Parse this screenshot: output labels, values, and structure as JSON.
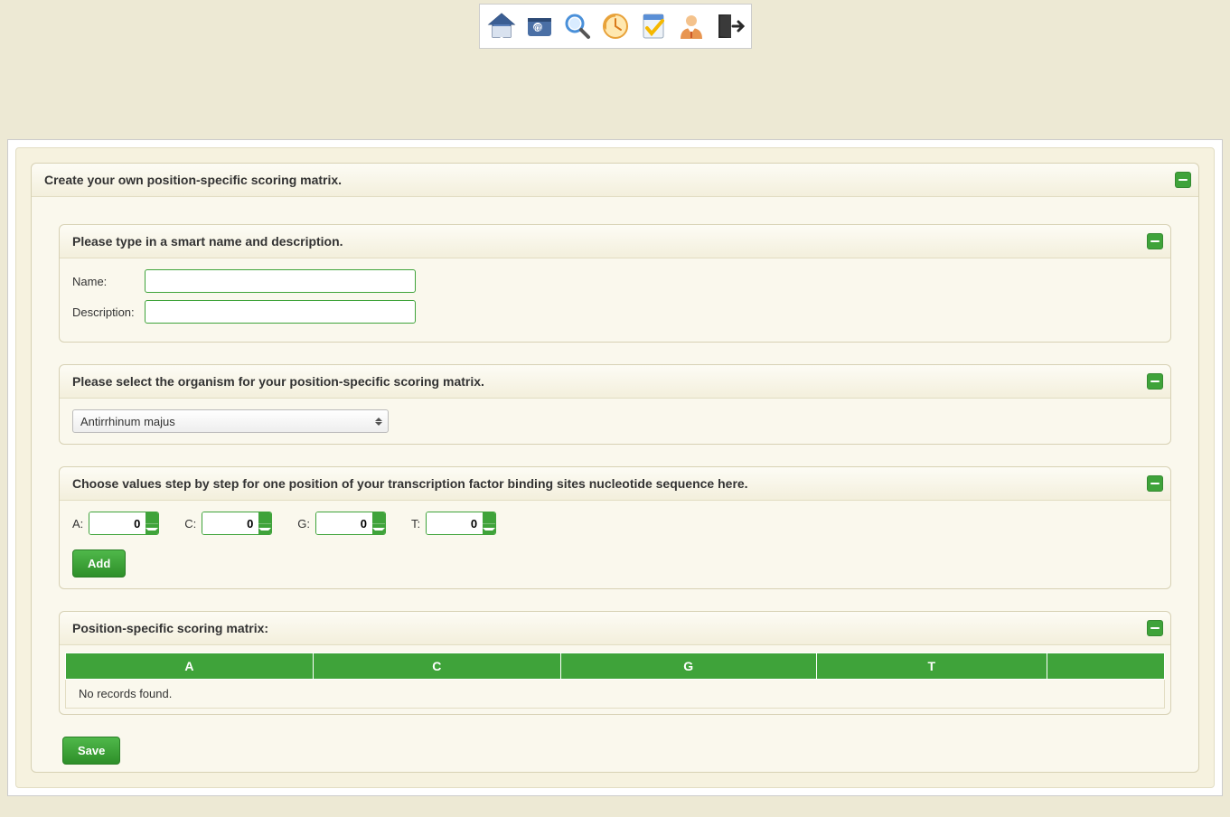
{
  "toolbar": {
    "icons": [
      "home-icon",
      "mail-icon",
      "search-icon",
      "history-icon",
      "tasks-icon",
      "user-icon",
      "exit-icon"
    ]
  },
  "main": {
    "title": "Create your own position-specific scoring matrix.",
    "section_name_desc": {
      "title": "Please type in a smart name and description.",
      "name_label": "Name:",
      "desc_label": "Description:",
      "name_value": "",
      "desc_value": ""
    },
    "section_organism": {
      "title": "Please select the organism for your position-specific scoring matrix.",
      "selected": "Antirrhinum majus"
    },
    "section_values": {
      "title": "Choose values step by step for one position of your transcription factor binding sites nucleotide sequence here.",
      "labels": {
        "a": "A:",
        "c": "C:",
        "g": "G:",
        "t": "T:"
      },
      "values": {
        "a": "0",
        "c": "0",
        "g": "0",
        "t": "0"
      },
      "add_label": "Add"
    },
    "section_matrix": {
      "title": "Position-specific scoring matrix:",
      "columns": [
        "A",
        "C",
        "G",
        "T"
      ],
      "no_records": "No records found."
    },
    "save_label": "Save"
  }
}
